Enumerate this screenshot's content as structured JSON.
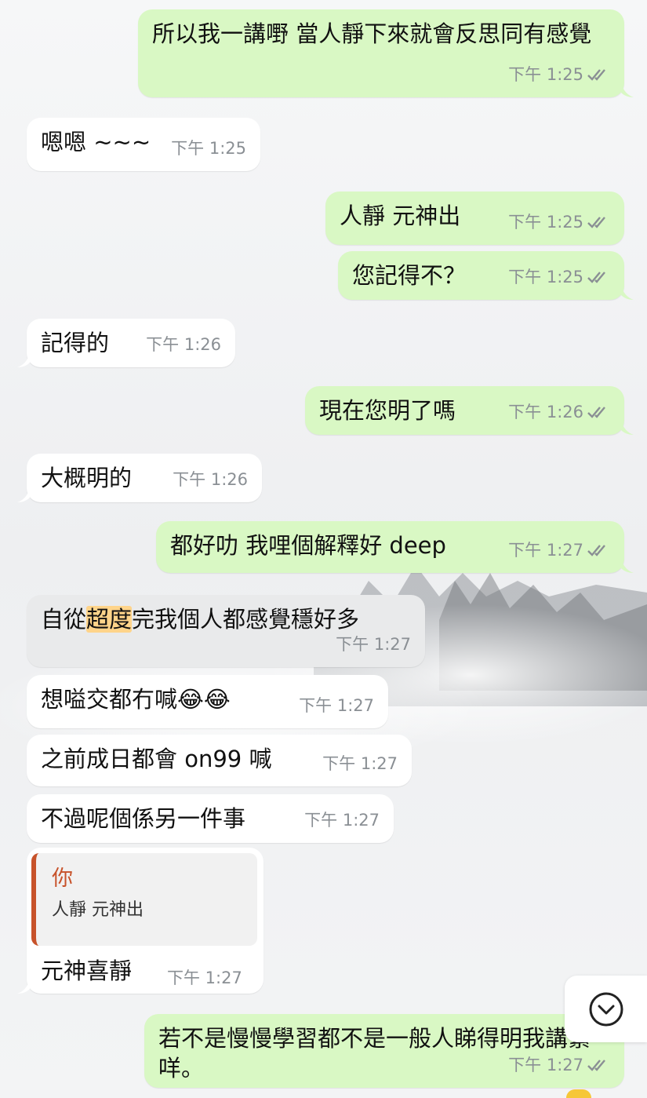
{
  "messages": [
    {
      "id": "m1",
      "text": "所以我一講嘢 當人靜下來就會反思同有感覺",
      "time": "下午 1:25"
    },
    {
      "id": "m2",
      "text": "嗯嗯 ~~~",
      "time": "下午 1:25"
    },
    {
      "id": "m3",
      "text": "人靜 元神出",
      "time": "下午 1:25"
    },
    {
      "id": "m4",
      "text": "您記得不？",
      "time": "下午 1:25"
    },
    {
      "id": "m5",
      "text": "記得的",
      "time": "下午 1:26"
    },
    {
      "id": "m6",
      "text": "現在您明了嗎",
      "time": "下午 1:26"
    },
    {
      "id": "m7",
      "text": "大概明的",
      "time": "下午 1:26"
    },
    {
      "id": "m8",
      "text": "都好叻 我哩個解釋好 deep",
      "time": "下午 1:27"
    },
    {
      "id": "m9",
      "text_before": "自從",
      "text_highlight": "超度",
      "text_after": "完我個人都感覺穩好多",
      "time": "下午 1:27"
    },
    {
      "id": "m10",
      "text": "想嗌交都冇喊",
      "emoji": "😂😂",
      "time": "下午 1:27"
    },
    {
      "id": "m11",
      "text": "之前成日都會 on99 喊",
      "time": "下午 1:27"
    },
    {
      "id": "m12",
      "text": "不過呢個係另一件事",
      "time": "下午 1:27"
    },
    {
      "id": "m13",
      "text": "元神喜靜",
      "time": "下午 1:27",
      "reply": {
        "name": "你",
        "text": "人靜 元神出"
      }
    },
    {
      "id": "m14",
      "text": "若不是慢慢學習都不是一般人睇得明我講緊咩。",
      "time": "下午 1:27"
    }
  ],
  "icons": {
    "read_receipt": "double-check-icon",
    "scroll_down": "chevron-down-icon"
  },
  "colors": {
    "outgoing": "#d9f8c4",
    "incoming": "#ffffff",
    "highlight": "#ffd48a",
    "ticks": "#8a8f94",
    "reply_accent": "#c7522a"
  }
}
